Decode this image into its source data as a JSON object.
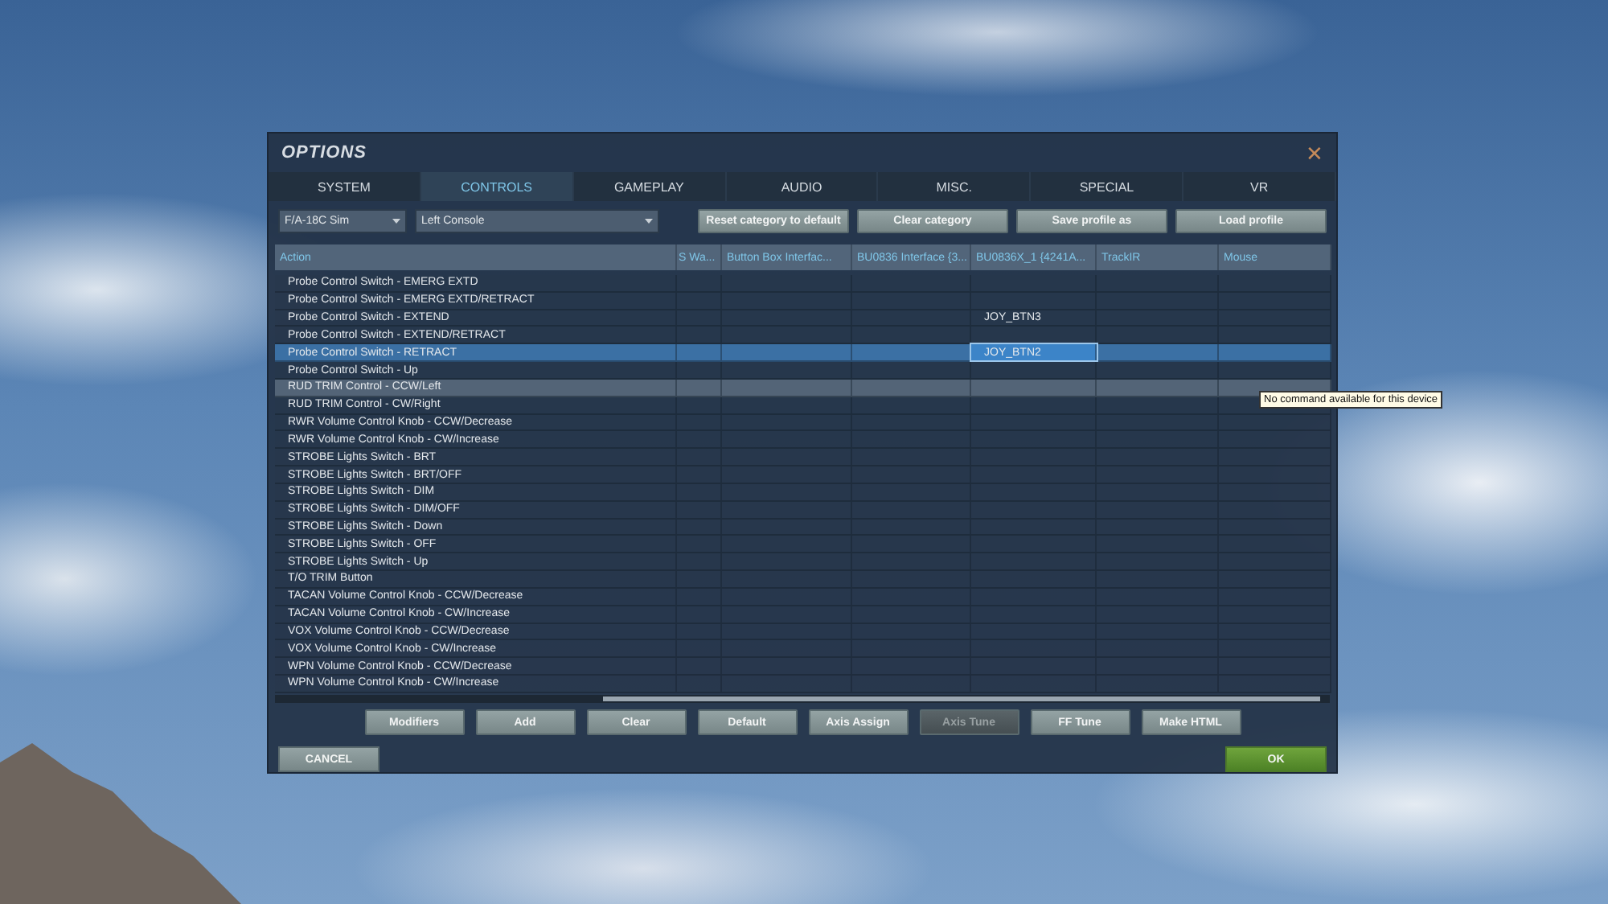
{
  "window": {
    "title": "OPTIONS",
    "close": "✕"
  },
  "tabs": [
    {
      "label": "SYSTEM",
      "selected": false
    },
    {
      "label": "CONTROLS",
      "selected": true
    },
    {
      "label": "GAMEPLAY",
      "selected": false
    },
    {
      "label": "AUDIO",
      "selected": false
    },
    {
      "label": "MISC.",
      "selected": false
    },
    {
      "label": "SPECIAL",
      "selected": false
    },
    {
      "label": "VR",
      "selected": false
    }
  ],
  "toolbar": {
    "aircraft": "F/A-18C Sim",
    "category": "Left Console",
    "buttons": [
      "Reset category to default",
      "Clear category",
      "Save profile as",
      "Load profile"
    ]
  },
  "table": {
    "columns": [
      "Action",
      "S Wa...",
      "Button Box Interfac...",
      "BU0836 Interface {3...",
      "BU0836X_1 {4241A...",
      "TrackIR",
      "Mouse"
    ],
    "rows": [
      {
        "action": "Probe Control Switch - EMERG EXTD",
        "selected": false,
        "hovered": false
      },
      {
        "action": "Probe Control Switch - EMERG EXTD/RETRACT",
        "selected": false,
        "hovered": false
      },
      {
        "action": "Probe Control Switch - EXTEND",
        "selected": false,
        "hovered": false,
        "bu0836x_1_binding": "JOY_BTN3"
      },
      {
        "action": "Probe Control Switch - EXTEND/RETRACT",
        "selected": false,
        "hovered": false
      },
      {
        "action": "Probe Control Switch - RETRACT",
        "selected": true,
        "hovered": false,
        "bu0836x_1_binding": "JOY_BTN2"
      },
      {
        "action": "Probe Control Switch - Up",
        "selected": false,
        "hovered": false
      },
      {
        "action": "RUD TRIM Control - CCW/Left",
        "selected": false,
        "hovered": true
      },
      {
        "action": "RUD TRIM Control - CW/Right",
        "selected": false,
        "hovered": false
      },
      {
        "action": "RWR Volume Control Knob - CCW/Decrease",
        "selected": false,
        "hovered": false
      },
      {
        "action": "RWR Volume Control Knob - CW/Increase",
        "selected": false,
        "hovered": false
      },
      {
        "action": "STROBE Lights Switch - BRT",
        "selected": false,
        "hovered": false
      },
      {
        "action": "STROBE Lights Switch - BRT/OFF",
        "selected": false,
        "hovered": false
      },
      {
        "action": "STROBE Lights Switch - DIM",
        "selected": false,
        "hovered": false
      },
      {
        "action": "STROBE Lights Switch - DIM/OFF",
        "selected": false,
        "hovered": false
      },
      {
        "action": "STROBE Lights Switch - Down",
        "selected": false,
        "hovered": false
      },
      {
        "action": "STROBE Lights Switch - OFF",
        "selected": false,
        "hovered": false
      },
      {
        "action": "STROBE Lights Switch - Up",
        "selected": false,
        "hovered": false
      },
      {
        "action": "T/O TRIM Button",
        "selected": false,
        "hovered": false
      },
      {
        "action": "TACAN Volume Control Knob - CCW/Decrease",
        "selected": false,
        "hovered": false
      },
      {
        "action": "TACAN Volume Control Knob - CW/Increase",
        "selected": false,
        "hovered": false
      },
      {
        "action": "VOX Volume Control Knob - CCW/Decrease",
        "selected": false,
        "hovered": false
      },
      {
        "action": "VOX Volume Control Knob - CW/Increase",
        "selected": false,
        "hovered": false
      },
      {
        "action": "WPN Volume Control Knob - CCW/Decrease",
        "selected": false,
        "hovered": false
      },
      {
        "action": "WPN Volume Control Knob - CW/Increase",
        "selected": false,
        "hovered": false
      }
    ]
  },
  "tooltip": "No command available for this device",
  "actions": [
    {
      "label": "Modifiers",
      "disabled": false
    },
    {
      "label": "Add",
      "disabled": false
    },
    {
      "label": "Clear",
      "disabled": false
    },
    {
      "label": "Default",
      "disabled": false
    },
    {
      "label": "Axis Assign",
      "disabled": false
    },
    {
      "label": "Axis Tune",
      "disabled": true
    },
    {
      "label": "FF Tune",
      "disabled": false
    },
    {
      "label": "Make HTML",
      "disabled": false
    }
  ],
  "footer": [
    {
      "label": "CANCEL",
      "kind": "cancel"
    },
    {
      "label": "OK",
      "kind": "confirm"
    }
  ]
}
